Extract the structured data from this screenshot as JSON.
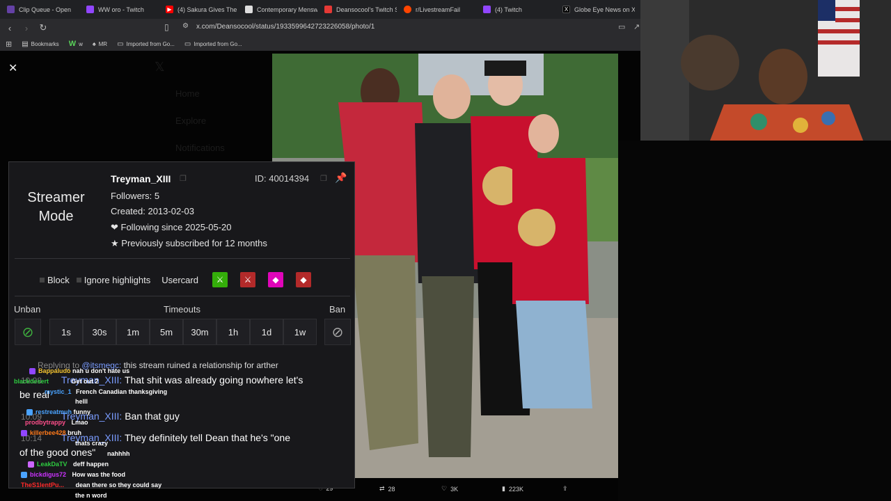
{
  "tabs": [
    {
      "label": "Clip Queue - Open",
      "color": "#6441a5"
    },
    {
      "label": "WW oro - Twitch",
      "color": "#9146ff"
    },
    {
      "label": "(4) Sakura Gives The W",
      "color": "#ff0000"
    },
    {
      "label": "Contemporary Mensw",
      "color": "#ffffff"
    },
    {
      "label": "Deansocool's Twitch St",
      "color": "#e53935"
    },
    {
      "label": "r/LivestreamFail",
      "color": "#ff4500"
    },
    {
      "label": "(4) Twitch",
      "color": "#9146ff"
    },
    {
      "label": "Globe Eye News on X:",
      "color": "#000000"
    }
  ],
  "url": "x.com/Deansocool/status/1933599642723226058/photo/1",
  "bookmarks": [
    {
      "label": "Bookmarks",
      "icon": "bookmark-icon"
    },
    {
      "label": "w",
      "icon": "w-logo-icon"
    },
    {
      "label": "MR",
      "icon": "mr-icon"
    },
    {
      "label": "Imported from Go...",
      "icon": "folder-icon"
    },
    {
      "label": "Imported from Go...",
      "icon": "folder-icon"
    }
  ],
  "ghost_nav": [
    "Home",
    "Explore",
    "Notifications"
  ],
  "stats": {
    "replies": "29",
    "reposts": "28",
    "likes": "3K",
    "views": "223K"
  },
  "usercard": {
    "streamer_mode": "Streamer Mode",
    "username": "Treyman_XIII",
    "id": "ID: 40014394",
    "followers": "Followers: 5",
    "created": "Created: 2013-02-03",
    "following": "Following since 2025-05-20",
    "subscribed": "Previously subscribed for 12 months",
    "block": "Block",
    "ignore": "Ignore highlights",
    "usercard": "Usercard",
    "unban": "Unban",
    "timeouts_label": "Timeouts",
    "ban": "Ban",
    "timeouts": [
      "1s",
      "30s",
      "1m",
      "5m",
      "30m",
      "1h",
      "1d",
      "1w"
    ]
  },
  "chat": {
    "reply_prefix": "Replying to",
    "reply_to": "@itsmegc:",
    "reply_text": "this stream ruined a relationship for arther",
    "big_messages": [
      {
        "time": "10:08",
        "user": "Treyman_XIII:",
        "text": "That shit was already going nowhere let's",
        "cont": "be real"
      },
      {
        "time": "10:09",
        "user": "Treyman_XIII:",
        "text": "Ban that guy"
      },
      {
        "time": "10:14",
        "user": "Treyman_XIII:",
        "text": "They definitely tell Dean that he's \"one",
        "cont": "of the good ones\""
      }
    ],
    "small_messages": [
      {
        "user": "Bappaludo",
        "text": "nah u don't hate us",
        "color": "#f4c430"
      },
      {
        "user": "blackdesert",
        "text": "Get out 2",
        "color": "#2ecc40"
      },
      {
        "user": "mystic_1",
        "text": "French Canadian thanksgiving",
        "color": "#4aa3ff"
      },
      {
        "user": "",
        "text": "helll",
        "color": "#ffffff"
      },
      {
        "user": "restreatmuh",
        "text": "funny",
        "color": "#4aa3ff"
      },
      {
        "user": "prodbytrappy",
        "text": "Lmao",
        "color": "#ff4f8b"
      },
      {
        "user": "killerbee428",
        "text": "bruh",
        "color": "#ff7a1a"
      },
      {
        "user": "",
        "text": "thats crazy",
        "color": "#4a6bff"
      },
      {
        "user": "",
        "text": "nahhhh",
        "color": "#ff2a2a"
      },
      {
        "user": "LeakDaTV",
        "text": "deff happen",
        "color": "#2ecc40"
      },
      {
        "user": "bickdigus72",
        "text": "How was the food",
        "color": "#cc33ff"
      },
      {
        "user": "TheS1lentPu...",
        "text": "dean there so they could say",
        "color": "#ff2a2a"
      },
      {
        "user": "",
        "text": "the n word",
        "color": "#ffffff"
      }
    ]
  }
}
